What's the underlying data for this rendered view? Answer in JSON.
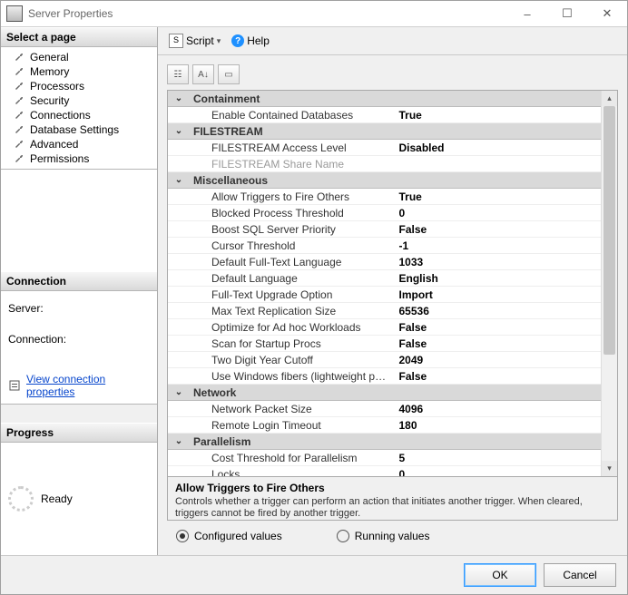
{
  "window": {
    "title": "Server Properties"
  },
  "winbuttons": {
    "min": "–",
    "max": "☐",
    "close": "✕"
  },
  "sidebar": {
    "select_page": "Select a page",
    "pages": [
      "General",
      "Memory",
      "Processors",
      "Security",
      "Connections",
      "Database Settings",
      "Advanced",
      "Permissions"
    ],
    "connection_hdr": "Connection",
    "server_label": "Server:",
    "connection_label": "Connection:",
    "view_props": "View connection properties",
    "progress_hdr": "Progress",
    "progress_text": "Ready"
  },
  "toolbar": {
    "script": "Script",
    "help": "Help"
  },
  "grid": {
    "categories": [
      {
        "name": "Containment",
        "rows": [
          {
            "label": "Enable Contained Databases",
            "value": "True"
          }
        ]
      },
      {
        "name": "FILESTREAM",
        "rows": [
          {
            "label": "FILESTREAM Access Level",
            "value": "Disabled"
          },
          {
            "label": "FILESTREAM Share Name",
            "value": "",
            "disabled": true
          }
        ]
      },
      {
        "name": "Miscellaneous",
        "rows": [
          {
            "label": "Allow Triggers to Fire Others",
            "value": "True"
          },
          {
            "label": "Blocked Process Threshold",
            "value": "0"
          },
          {
            "label": "Boost SQL Server Priority",
            "value": "False"
          },
          {
            "label": "Cursor Threshold",
            "value": "-1"
          },
          {
            "label": "Default Full-Text Language",
            "value": "1033"
          },
          {
            "label": "Default Language",
            "value": "English"
          },
          {
            "label": "Full-Text Upgrade Option",
            "value": "Import"
          },
          {
            "label": "Max Text Replication Size",
            "value": "65536"
          },
          {
            "label": "Optimize for Ad hoc Workloads",
            "value": "False"
          },
          {
            "label": "Scan for Startup Procs",
            "value": "False"
          },
          {
            "label": "Two Digit Year Cutoff",
            "value": "2049"
          },
          {
            "label": "Use Windows fibers (lightweight pooling)",
            "value": "False"
          }
        ]
      },
      {
        "name": "Network",
        "rows": [
          {
            "label": "Network Packet Size",
            "value": "4096"
          },
          {
            "label": "Remote Login Timeout",
            "value": "180"
          }
        ]
      },
      {
        "name": "Parallelism",
        "rows": [
          {
            "label": "Cost Threshold for Parallelism",
            "value": "5"
          },
          {
            "label": "Locks",
            "value": "0"
          }
        ]
      }
    ]
  },
  "description": {
    "title": "Allow Triggers to Fire Others",
    "text": "Controls whether a trigger can perform an action that initiates another trigger. When cleared, triggers cannot be fired by another trigger."
  },
  "radios": {
    "configured": "Configured values",
    "running": "Running values"
  },
  "footer": {
    "ok": "OK",
    "cancel": "Cancel"
  }
}
